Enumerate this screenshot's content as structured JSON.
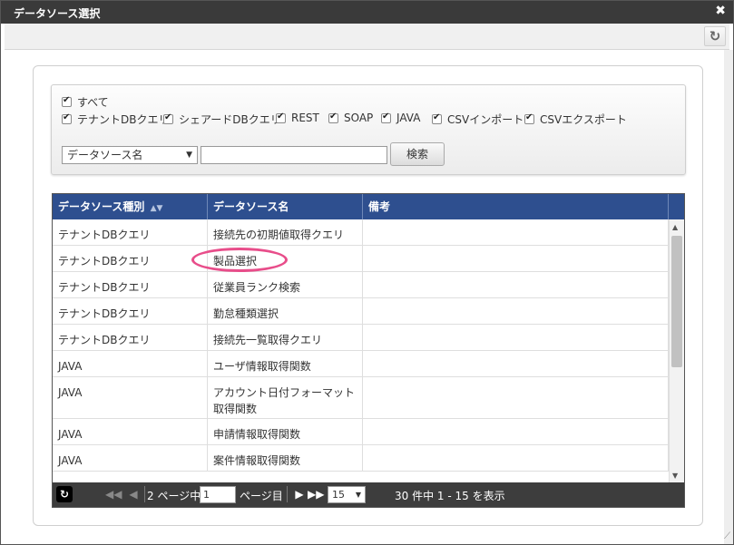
{
  "dialog": {
    "title": "データソース選択",
    "close_icon": "✖",
    "refresh_icon": "refresh-icon"
  },
  "filter": {
    "all_label": "すべて",
    "checkboxes": [
      {
        "label": "テナントDBクエリ",
        "checked": true
      },
      {
        "label": "シェアードDBクエリ",
        "checked": true
      },
      {
        "label": "REST",
        "checked": true
      },
      {
        "label": "SOAP",
        "checked": true
      },
      {
        "label": "JAVA",
        "checked": true
      },
      {
        "label": "CSVインポート",
        "checked": true
      },
      {
        "label": "CSVエクスポート",
        "checked": true
      }
    ],
    "search_field_selected": "データソース名",
    "search_value": "",
    "search_button": "検索"
  },
  "grid": {
    "columns": [
      "データソース種別",
      "データソース名",
      "備考"
    ],
    "rows": [
      {
        "type": "テナントDBクエリ",
        "name": "接続先の初期値取得クエリ",
        "note": ""
      },
      {
        "type": "テナントDBクエリ",
        "name": "製品選択",
        "note": ""
      },
      {
        "type": "テナントDBクエリ",
        "name": "従業員ランク検索",
        "note": ""
      },
      {
        "type": "テナントDBクエリ",
        "name": "勤怠種類選択",
        "note": ""
      },
      {
        "type": "テナントDBクエリ",
        "name": "接続先一覧取得クエリ",
        "note": ""
      },
      {
        "type": "JAVA",
        "name": "ユーザ情報取得関数",
        "note": ""
      },
      {
        "type": "JAVA",
        "name": "アカウント日付フォーマット取得関数",
        "note": ""
      },
      {
        "type": "JAVA",
        "name": "申請情報取得関数",
        "note": ""
      },
      {
        "type": "JAVA",
        "name": "案件情報取得関数",
        "note": ""
      }
    ]
  },
  "pager": {
    "page_prefix": "2 ページ中",
    "current_page": "1",
    "page_suffix": "ページ目",
    "per_page": "15",
    "summary": "30 件中 1 - 15 を表示"
  }
}
